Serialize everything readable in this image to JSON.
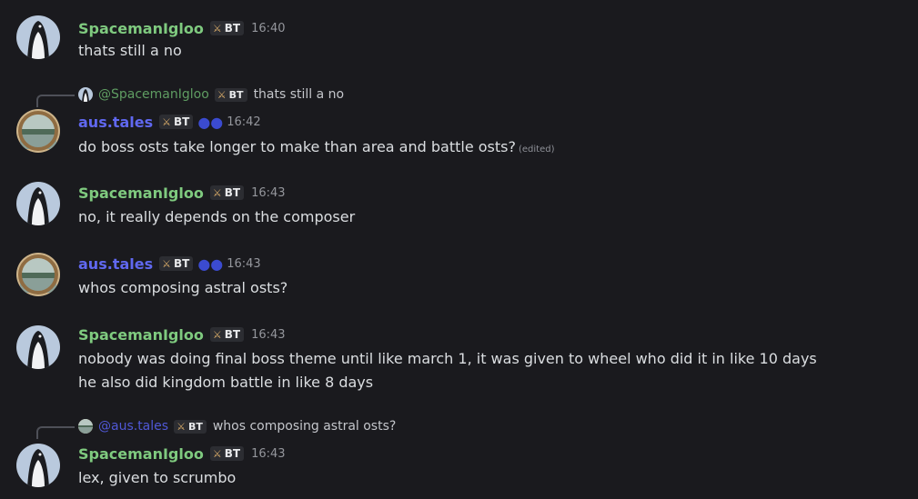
{
  "colors": {
    "spaceman": "#7fca7f",
    "spaceman_reply": "#5f9d62",
    "aus": "#6068f0",
    "aus_reply": "#5058d6",
    "background": "#1a1a1e"
  },
  "badge": {
    "icon": "crossed-swords-icon",
    "label": "BT"
  },
  "messages": [
    {
      "author": "SpacemanIgloo",
      "time": "16:40",
      "lines": [
        "thats still a no"
      ]
    },
    {
      "reply_to": {
        "author": "@SpacemanIgloo",
        "text": "thats still a no"
      },
      "author": "aus.tales",
      "time": "16:42",
      "lines": [
        "do boss osts take longer to make than area and battle osts?"
      ],
      "edited": "(edited)"
    },
    {
      "author": "SpacemanIgloo",
      "time": "16:43",
      "lines": [
        "no, it really depends on the composer"
      ]
    },
    {
      "author": "aus.tales",
      "time": "16:43",
      "lines": [
        "whos composing astral osts?"
      ]
    },
    {
      "author": "SpacemanIgloo",
      "time": "16:43",
      "lines": [
        "nobody was doing final boss theme until like march 1, it was given to wheel who did it in like 10 days",
        "he also did kingdom battle in like 8 days"
      ]
    },
    {
      "reply_to": {
        "author": "@aus.tales",
        "text": "whos composing astral osts?"
      },
      "author": "SpacemanIgloo",
      "time": "16:43",
      "lines": [
        "lex, given to scrumbo"
      ]
    }
  ]
}
